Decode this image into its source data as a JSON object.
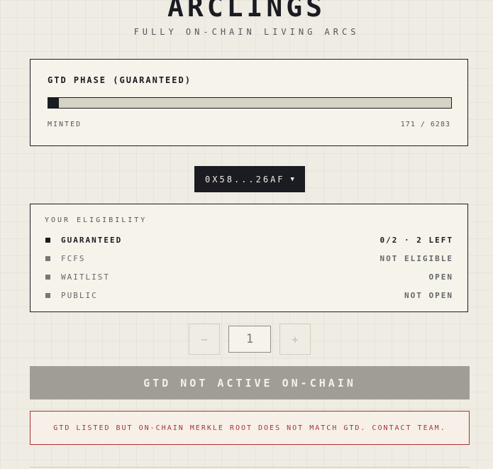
{
  "header": {
    "title": "ARCLINGS",
    "subtitle": "FULLY ON-CHAIN LIVING ARCS"
  },
  "phase": {
    "title": "GTD PHASE (GUARANTEED)",
    "minted_label": "MINTED",
    "minted_count": "171 / 6283",
    "progress_fraction": 0.0272
  },
  "wallet": {
    "address": "0X58...26AF",
    "caret": "▼"
  },
  "eligibility": {
    "title": "YOUR ELIGIBILITY",
    "rows": [
      {
        "name": "GUARANTEED",
        "status": "0/2 · 2 LEFT",
        "active": true
      },
      {
        "name": "FCFS",
        "status": "NOT ELIGIBLE",
        "active": false
      },
      {
        "name": "WAITLIST",
        "status": "OPEN",
        "active": false
      },
      {
        "name": "PUBLIC",
        "status": "NOT OPEN",
        "active": false
      }
    ]
  },
  "quantity": {
    "minus_label": "−",
    "value": "1",
    "plus_label": "+"
  },
  "mint_button": {
    "label": "GTD NOT ACTIVE ON-CHAIN"
  },
  "error": {
    "message": "GTD LISTED BUT ON-CHAIN MERKLE ROOT DOES NOT MATCH GTD. CONTACT TEAM."
  },
  "colors": {
    "background": "#efece4",
    "ink": "#1b1b22",
    "disabled": "#9f9d96",
    "error": "#a83434"
  }
}
